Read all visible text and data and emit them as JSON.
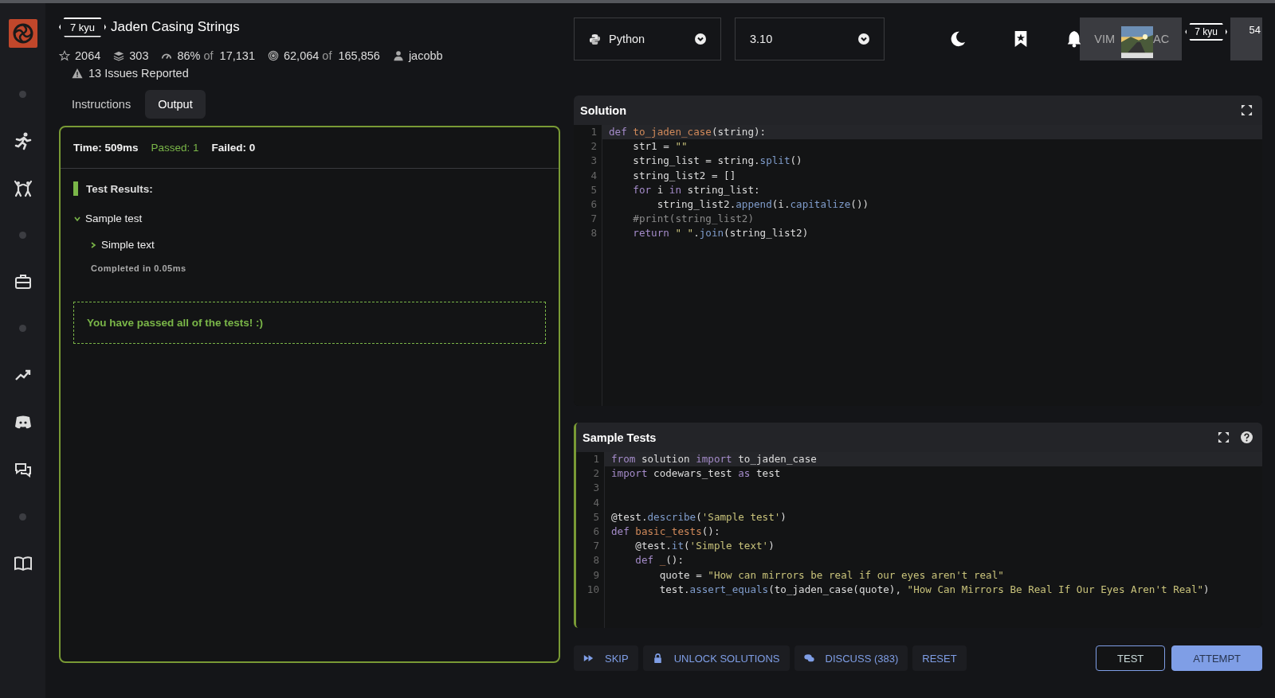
{
  "sidebar": [
    {
      "kind": "logo"
    },
    {
      "kind": "dot"
    },
    {
      "kind": "run"
    },
    {
      "kind": "fight"
    },
    {
      "kind": "dot"
    },
    {
      "kind": "work"
    },
    {
      "kind": "dot"
    },
    {
      "kind": "trend"
    },
    {
      "kind": "discord"
    },
    {
      "kind": "chat"
    },
    {
      "kind": "dot"
    },
    {
      "kind": "book"
    }
  ],
  "kata": {
    "rank": "7 kyu",
    "title": "Jaden Casing Strings",
    "stats": [
      {
        "kind": "star",
        "text": "2064"
      },
      {
        "kind": "stack",
        "text": "303"
      },
      {
        "kind": "gauge",
        "text": "86%",
        "of": "of",
        "total": "17,131"
      },
      {
        "kind": "target",
        "text": "62,064",
        "of": "of",
        "total": "165,856"
      },
      {
        "kind": "user",
        "text": "jacobb"
      }
    ],
    "issues": "13 Issues Reported"
  },
  "tabs": [
    {
      "label": "Instructions",
      "selected": false
    },
    {
      "label": "Output",
      "selected": true
    }
  ],
  "output": {
    "summary": [
      {
        "text": "Time: 509ms",
        "kind": "info"
      },
      {
        "text": "Passed: 1",
        "kind": "pass"
      },
      {
        "text": "Failed: 0",
        "kind": "info"
      }
    ],
    "heading": "Test Results:",
    "tree": [
      {
        "label": "Sample test",
        "expanded": true,
        "children": [
          {
            "label": "Simple text",
            "expanded": false
          }
        ],
        "completed": "Completed in 0.05ms"
      }
    ],
    "message": "You have passed all of the tests! :)"
  },
  "language": {
    "value": "Python"
  },
  "version": {
    "value": "3.10"
  },
  "top_right": {
    "mode": "VIM",
    "mode_partial": "AC",
    "rank": "7 kyu",
    "count": "54"
  },
  "solution": {
    "title": "Solution",
    "lines": [
      {
        "number": "1",
        "active": true,
        "tokens": [
          {
            "t": "def",
            "kind": "kw"
          },
          {
            "t": " to_jaden_case",
            "kind": "fn"
          },
          {
            "t": "(string):",
            "kind": "p"
          }
        ]
      },
      {
        "number": "2",
        "active": false,
        "tokens": [
          {
            "t": "    str1 = ",
            "kind": "p"
          },
          {
            "t": "\"\"",
            "kind": "s"
          }
        ]
      },
      {
        "number": "3",
        "active": false,
        "tokens": [
          {
            "t": "    string_list = string.",
            "kind": "p"
          },
          {
            "t": "split",
            "kind": "m"
          },
          {
            "t": "()",
            "kind": "p"
          }
        ]
      },
      {
        "number": "4",
        "active": false,
        "tokens": [
          {
            "t": "    string_list2 = []",
            "kind": "p"
          }
        ]
      },
      {
        "number": "5",
        "active": false,
        "tokens": [
          {
            "t": "    for",
            "kind": "kw"
          },
          {
            "t": " i ",
            "kind": "p"
          },
          {
            "t": "in",
            "kind": "kw"
          },
          {
            "t": " string_list:",
            "kind": "p"
          }
        ]
      },
      {
        "number": "6",
        "active": false,
        "tokens": [
          {
            "t": "        string_list2.",
            "kind": "p"
          },
          {
            "t": "append",
            "kind": "m"
          },
          {
            "t": "(i.",
            "kind": "p"
          },
          {
            "t": "capitalize",
            "kind": "m"
          },
          {
            "t": "())",
            "kind": "p"
          }
        ]
      },
      {
        "number": "7",
        "active": false,
        "tokens": [
          {
            "t": "    #print(string_list2)",
            "kind": "c"
          }
        ]
      },
      {
        "number": "8",
        "active": false,
        "tokens": [
          {
            "t": "    return",
            "kind": "kw"
          },
          {
            "t": " \" \"",
            "kind": "s"
          },
          {
            "t": ".",
            "kind": "p"
          },
          {
            "t": "join",
            "kind": "m"
          },
          {
            "t": "(string_list2)",
            "kind": "p"
          }
        ]
      }
    ]
  },
  "tests": {
    "title": "Sample Tests",
    "lines": [
      {
        "number": "1",
        "active": true,
        "tokens": [
          {
            "t": "from",
            "kind": "kw"
          },
          {
            "t": " solution ",
            "kind": "p"
          },
          {
            "t": "import",
            "kind": "kw"
          },
          {
            "t": " to_jaden_case",
            "kind": "p"
          }
        ]
      },
      {
        "number": "2",
        "active": false,
        "tokens": [
          {
            "t": "import",
            "kind": "kw"
          },
          {
            "t": " codewars_test ",
            "kind": "p"
          },
          {
            "t": "as",
            "kind": "kw"
          },
          {
            "t": " test",
            "kind": "p"
          }
        ]
      },
      {
        "number": "3",
        "active": false
      },
      {
        "number": "4",
        "active": false
      },
      {
        "number": "5",
        "active": false,
        "tokens": [
          {
            "t": "@test.",
            "kind": "p"
          },
          {
            "t": "describe",
            "kind": "m"
          },
          {
            "t": "(",
            "kind": "p"
          },
          {
            "t": "'Sample test'",
            "kind": "s"
          },
          {
            "t": ")",
            "kind": "p"
          }
        ]
      },
      {
        "number": "6",
        "active": false,
        "tokens": [
          {
            "t": "def",
            "kind": "kw"
          },
          {
            "t": " basic_tests",
            "kind": "fn"
          },
          {
            "t": "():",
            "kind": "p"
          }
        ]
      },
      {
        "number": "7",
        "active": false,
        "tokens": [
          {
            "t": "    @test.",
            "kind": "p"
          },
          {
            "t": "it",
            "kind": "m"
          },
          {
            "t": "(",
            "kind": "p"
          },
          {
            "t": "'Simple text'",
            "kind": "s"
          },
          {
            "t": ")",
            "kind": "p"
          }
        ]
      },
      {
        "number": "8",
        "active": false,
        "tokens": [
          {
            "t": "    def",
            "kind": "kw"
          },
          {
            "t": " _",
            "kind": "fn"
          },
          {
            "t": "():",
            "kind": "p"
          }
        ]
      },
      {
        "number": "9",
        "active": false,
        "tokens": [
          {
            "t": "        quote = ",
            "kind": "p"
          },
          {
            "t": "\"How can mirrors be real if our eyes aren't real\"",
            "kind": "s"
          }
        ]
      },
      {
        "number": "10",
        "active": false,
        "tokens": [
          {
            "t": "        test.",
            "kind": "p"
          },
          {
            "t": "assert_equals",
            "kind": "m"
          },
          {
            "t": "(to_jaden_case(quote), ",
            "kind": "p"
          },
          {
            "t": "\"How Can Mirrors Be Real If Our Eyes Aren't Real\"",
            "kind": "s"
          },
          {
            "t": ")",
            "kind": "p"
          }
        ]
      }
    ]
  },
  "actions": [
    {
      "label": "SKIP",
      "kind": "skip"
    },
    {
      "label": "UNLOCK SOLUTIONS",
      "kind": "lock"
    },
    {
      "label": "DISCUSS (383)",
      "kind": "discuss"
    },
    {
      "label": "RESET",
      "kind": "plain"
    }
  ],
  "submit": [
    {
      "label": "TEST",
      "kind": "outline"
    },
    {
      "label": "ATTEMPT",
      "kind": "solid"
    }
  ]
}
